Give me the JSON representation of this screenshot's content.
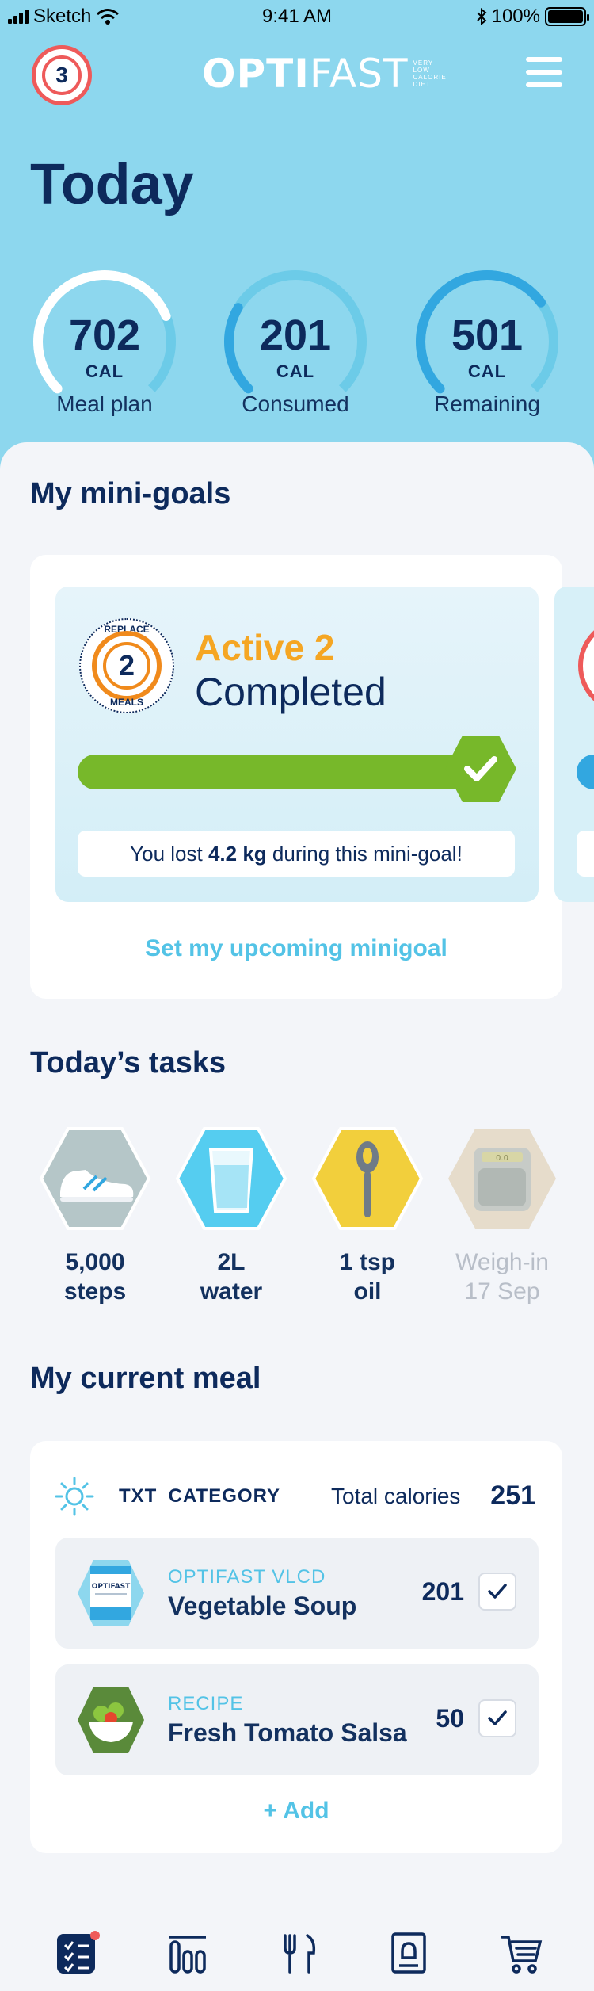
{
  "status_bar": {
    "carrier": "Sketch",
    "time": "9:41 AM",
    "battery": "100%"
  },
  "header": {
    "notifications_count": "3",
    "logo_bold": "OPTI",
    "logo_light": "FAST",
    "logo_tagline": [
      "VERY",
      "LOW",
      "CALORIE",
      "DIET"
    ]
  },
  "today": {
    "title": "Today"
  },
  "calories": [
    {
      "value": "702",
      "unit": "CAL",
      "label": "Meal plan",
      "progress": 0.75
    },
    {
      "value": "201",
      "unit": "CAL",
      "label": "Consumed",
      "progress": 0.28
    },
    {
      "value": "501",
      "unit": "CAL",
      "label": "Remaining",
      "progress": 0.7
    }
  ],
  "minigoals": {
    "heading": "My mini-goals",
    "medal_top": "REPLACE",
    "medal_number": "2",
    "medal_bottom": "MEALS",
    "status": "Active 2",
    "state": "Completed",
    "progress": 1.0,
    "lost_prefix": "You lost ",
    "lost_amount": "4.2 kg",
    "lost_suffix": " during this mini-goal!",
    "set_link": "Set my upcoming minigoal"
  },
  "tasks": {
    "heading": "Today’s tasks",
    "items": [
      {
        "line1": "5,000",
        "line2": "steps",
        "icon": "shoe-icon"
      },
      {
        "line1": "2L",
        "line2": "water",
        "icon": "water-glass-icon"
      },
      {
        "line1": "1 tsp",
        "line2": "oil",
        "icon": "spoon-icon"
      },
      {
        "line1": "Weigh-in",
        "line2": "17 Sep",
        "icon": "scale-icon"
      }
    ],
    "scale_reading": "0.0"
  },
  "meal": {
    "heading": "My current meal",
    "category": "TXT_CATEGORY",
    "total_label": "Total calories",
    "total_value": "251",
    "items": [
      {
        "type": "OPTIFAST VLCD",
        "name": "Vegetable Soup",
        "calories": "201",
        "checked": true,
        "packet_label": "OPTIFAST"
      },
      {
        "type": "RECIPE",
        "name": "Fresh Tomato Salsa",
        "calories": "50",
        "checked": true
      }
    ],
    "add_label": "+ Add"
  },
  "tabbar": [
    "tasks-icon",
    "stats-icon",
    "meals-icon",
    "recipes-icon",
    "shop-icon"
  ],
  "colors": {
    "sky": "#8dd7ee",
    "navy": "#0d2a5c",
    "accent_blue": "#53c3e6",
    "orange": "#f5a623",
    "green": "#77b82a",
    "red": "#ee5a5a"
  }
}
